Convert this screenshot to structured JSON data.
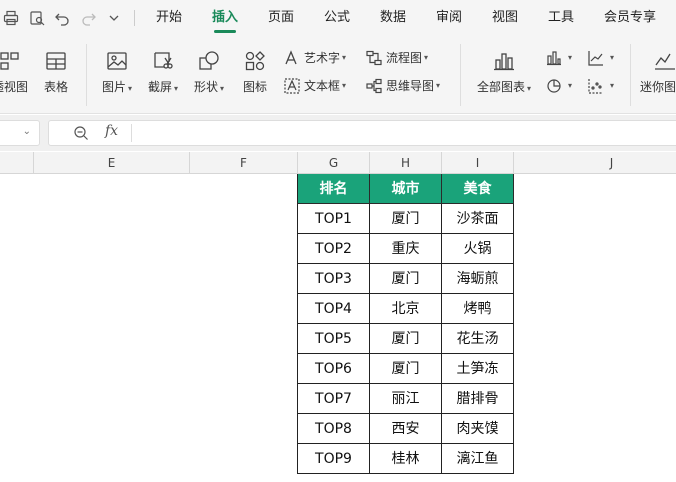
{
  "menubar": {
    "tabs": [
      {
        "label": "开始",
        "active": false
      },
      {
        "label": "插入",
        "active": true
      },
      {
        "label": "页面",
        "active": false
      },
      {
        "label": "公式",
        "active": false
      },
      {
        "label": "数据",
        "active": false
      },
      {
        "label": "审阅",
        "active": false
      },
      {
        "label": "视图",
        "active": false
      },
      {
        "label": "工具",
        "active": false
      },
      {
        "label": "会员专享",
        "active": false
      }
    ],
    "accent_color": "#1a8a5a"
  },
  "ribbon": {
    "pivot_view": "透视图",
    "table": "表格",
    "picture": "图片",
    "screenshot": "截屏",
    "shapes": "形状",
    "icons": "图标",
    "word_art": "艺术字",
    "text_box": "文本框",
    "flowchart": "流程图",
    "mind_map": "思维导图",
    "all_charts": "全部图表",
    "sparkline": "迷你图"
  },
  "formula_bar": {
    "fx_label": "fx",
    "value": ""
  },
  "columns": [
    "E",
    "F",
    "G",
    "H",
    "I",
    "J"
  ],
  "table": {
    "header_color": "#1aa37a",
    "headers": [
      "排名",
      "城市",
      "美食"
    ],
    "rows": [
      [
        "TOP1",
        "厦门",
        "沙茶面"
      ],
      [
        "TOP2",
        "重庆",
        "火锅"
      ],
      [
        "TOP3",
        "厦门",
        "海蛎煎"
      ],
      [
        "TOP4",
        "北京",
        "烤鸭"
      ],
      [
        "TOP5",
        "厦门",
        "花生汤"
      ],
      [
        "TOP6",
        "厦门",
        "土笋冻"
      ],
      [
        "TOP7",
        "丽江",
        "腊排骨"
      ],
      [
        "TOP8",
        "西安",
        "肉夹馍"
      ],
      [
        "TOP9",
        "桂林",
        "漓江鱼"
      ]
    ]
  }
}
